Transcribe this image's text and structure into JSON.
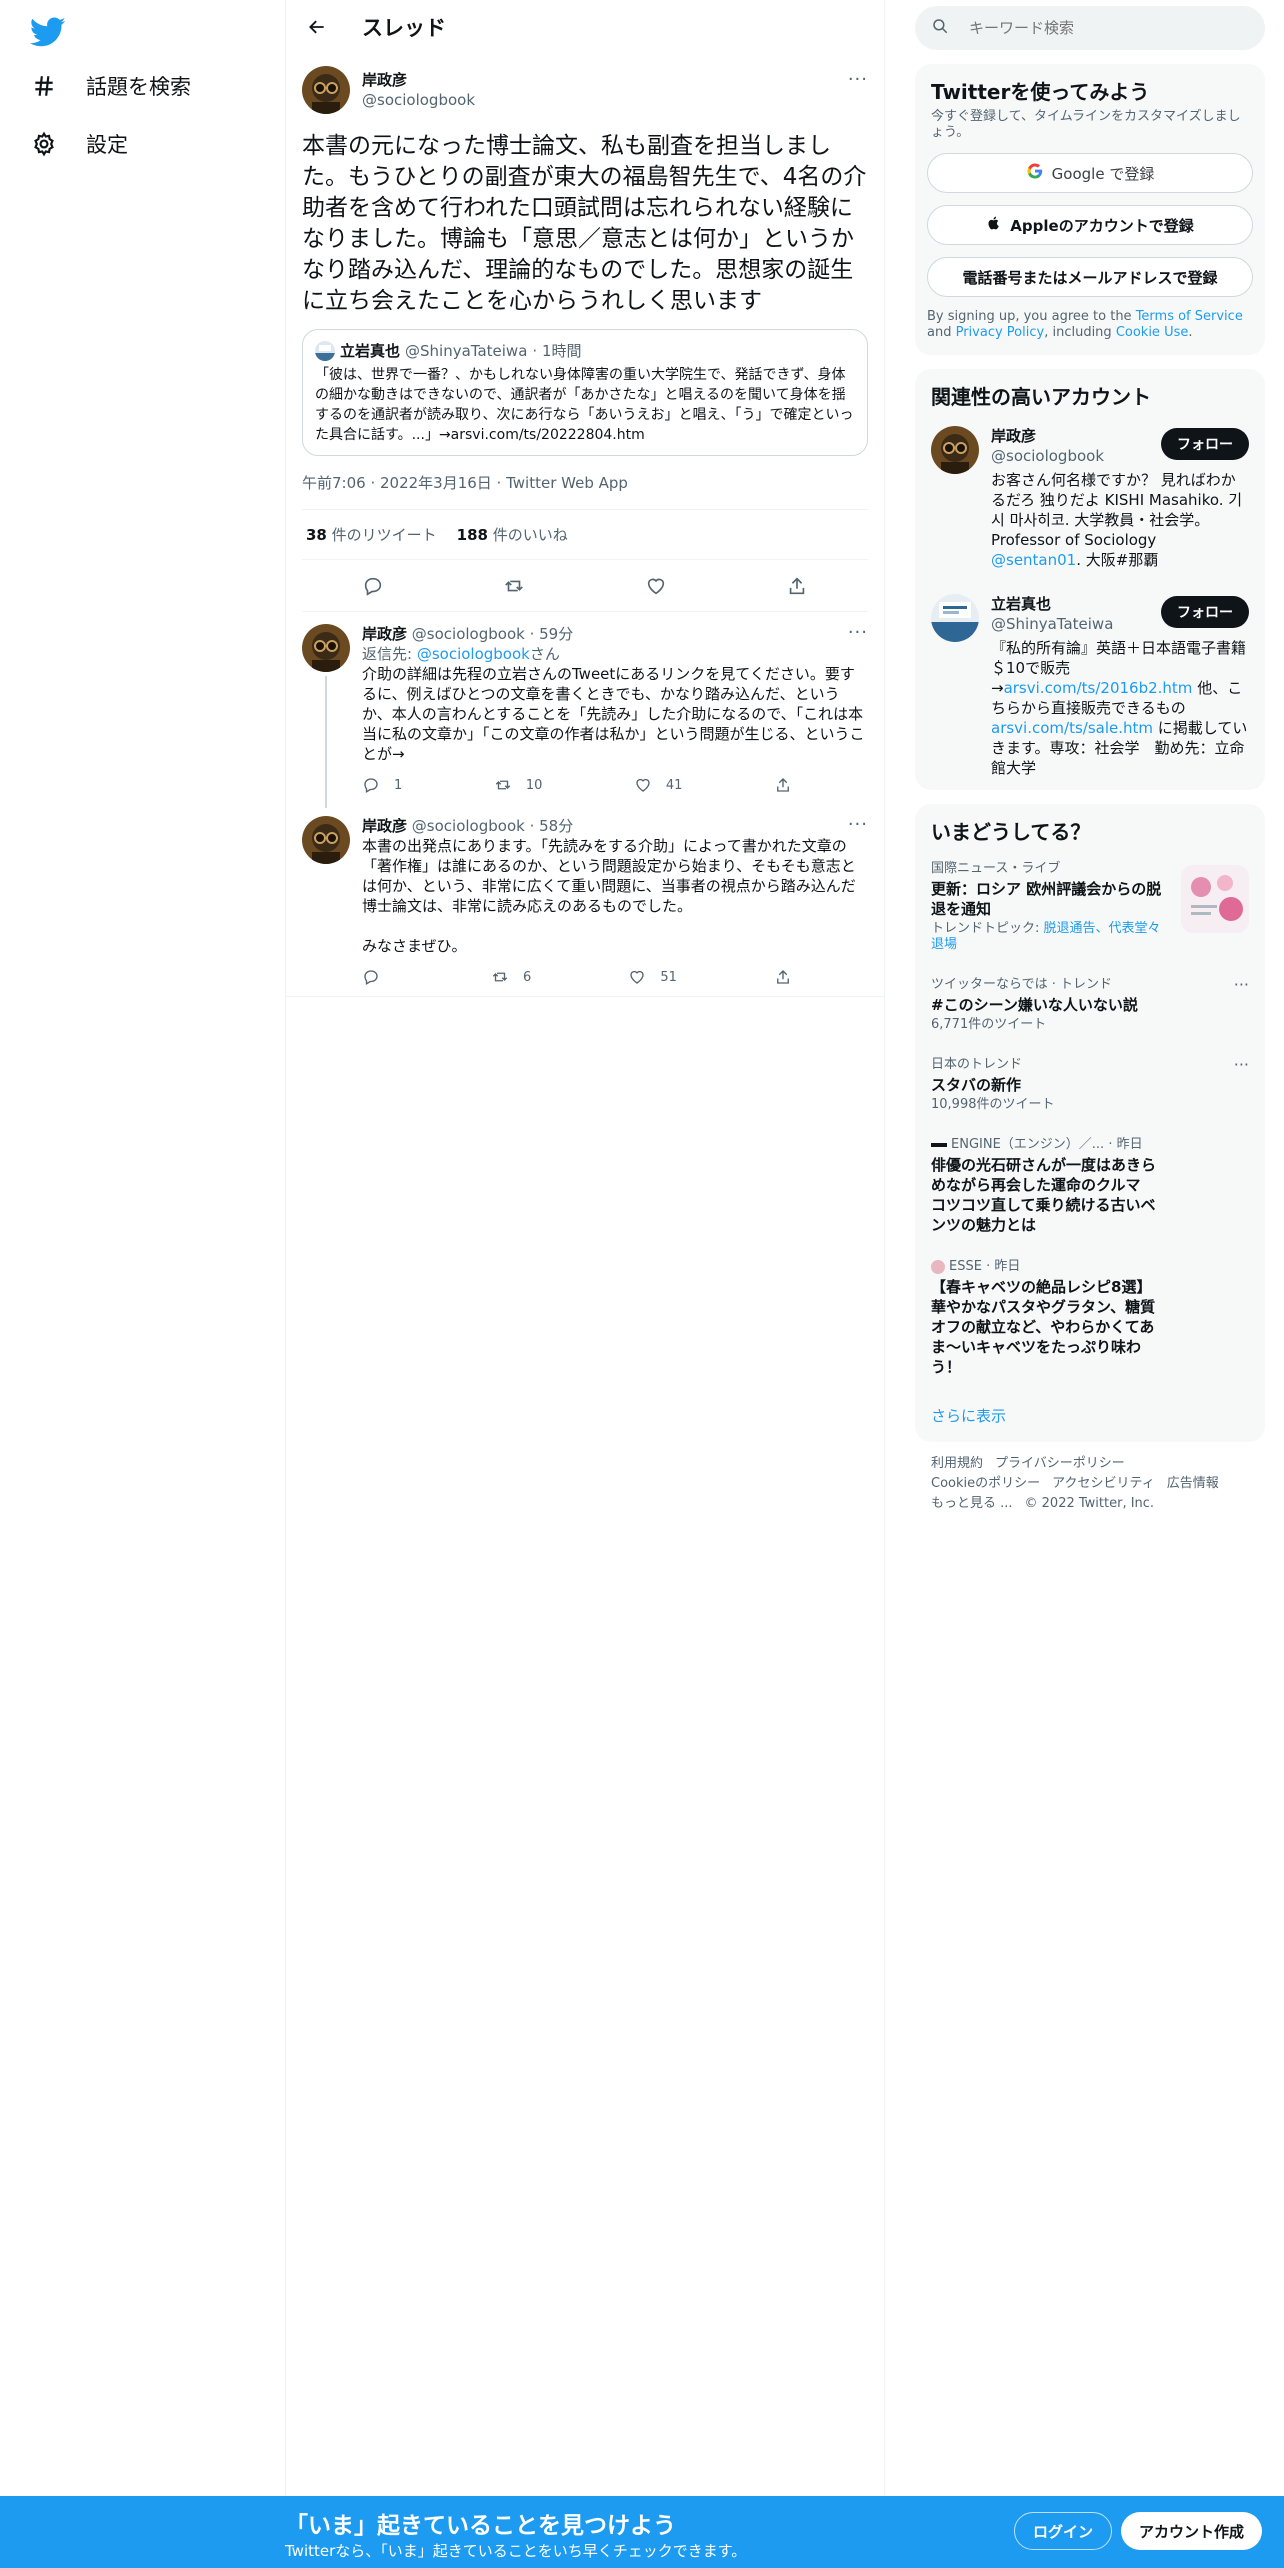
{
  "nav": {
    "items": [
      {
        "icon": "hashtag-icon",
        "label": "話題を検索"
      },
      {
        "icon": "gear-icon",
        "label": "設定"
      }
    ]
  },
  "header": {
    "title": "スレッド"
  },
  "main_tweet": {
    "name": "岸政彦",
    "handle": "@sociologbook",
    "text": "本書の元になった博士論文、私も副査を担当しました。もうひとりの副査が東大の福島智先生で、4名の介助者を含めて行われた口頭試問は忘れられない経験になりました。博論も「意思／意志とは何か」というかなり踏み込んだ、理論的なものでした。思想家の誕生に立ち会えたことを心からうれしく思います",
    "quote": {
      "name": "立岩真也",
      "handle": "@ShinyaTateiwa",
      "time": "· 1時間",
      "text": "「彼は、世界で一番？、かもしれない身体障害の重い大学院生で、発話できず、身体の細かな動きはできないので、通訳者が「あかさたな」と唱えるのを聞いて身体を揺するのを通訳者が読み取り、次にあ行なら「あいうえお」と唱え、「う」で確定といった具合に話す。...」→arsvi.com/ts/20222804.htm"
    },
    "meta": "午前7:06 · 2022年3月16日 · Twitter Web App",
    "retweets_count": "38",
    "retweets_label": "件のリツイート",
    "likes_count": "188",
    "likes_label": "件のいいね"
  },
  "replies": [
    {
      "name": "岸政彦",
      "handle": "@sociologbook",
      "time": "· 59分",
      "reply_prefix": "返信先: ",
      "reply_to": "@sociologbook",
      "reply_suffix": "さん",
      "text": "介助の詳細は先程の立岩さんのTweetにあるリンクを見てください。要するに、例えばひとつの文章を書くときでも、かなり踏み込んだ、というか、本人の言わんとすることを「先読み」した介助になるので、「これは本当に私の文章か」「この文章の作者は私か」という問題が生じる、ということが→",
      "replies": "1",
      "retweets": "10",
      "likes": "41"
    },
    {
      "name": "岸政彦",
      "handle": "@sociologbook",
      "time": "· 58分",
      "text": "本書の出発点にあります。「先読みをする介助」によって書かれた文章の「著作権」は誰にあるのか、という問題設定から始まり、そもそも意志とは何か、という、非常に広くて重い問題に、当事者の視点から踏み込んだ博士論文は、非常に読み応えのあるものでした。\n\nみなさまぜひ。",
      "replies": "",
      "retweets": "6",
      "likes": "51"
    }
  ],
  "search": {
    "placeholder": "キーワード検索"
  },
  "signup": {
    "title": "Twitterを使ってみよう",
    "subtitle": "今すぐ登録して、タイムラインをカスタマイズしましょう。",
    "google": "Google で登録",
    "apple": "Appleのアカウントで登録",
    "phone": "電話番号またはメールアドレスで登録",
    "legal_1": "By signing up, you agree to the ",
    "terms": "Terms of Service",
    "legal_2": " and ",
    "privacy": "Privacy Policy",
    "legal_3": ", including ",
    "cookie": "Cookie Use",
    "legal_4": "."
  },
  "related": {
    "title": "関連性の高いアカウント",
    "follow_label": "フォロー",
    "accounts": [
      {
        "name": "岸政彦",
        "handle": "@sociologbook",
        "bio": "お客さん何名様ですか？ 見ればわかるだろ 独りだよ KISHI Masahiko. 기시 마사히코. 大学教員・社会学。Professor of Sociology ",
        "bio_link": "@sentan01",
        "bio_end": ". 大阪#那覇"
      },
      {
        "name": "立岩真也",
        "handle": "@ShinyaTateiwa",
        "bio": "『私的所有論』英語＋日本語電子書籍＄10で販売→",
        "bio_link": "arsvi.com/ts/2016b2.htm",
        "bio_mid": " 他、こちらから直接販売できるもの ",
        "bio_link2": "arsvi.com/ts/sale.htm",
        "bio_end": " に掲載していきます。専攻：社会学　勤め先：立命館大学"
      }
    ]
  },
  "trends": {
    "title": "いまどうしてる？",
    "items": [
      {
        "context": "国際ニュース・ライブ",
        "title": "更新：ロシア 欧州評議会からの脱退を通知",
        "topics_label": "トレンドトピック: ",
        "topics": "脱退通告、代表堂々退場"
      },
      {
        "context": "ツイッターならでは · トレンド",
        "title": "#このシーン嫌いな人いない説",
        "stat": "6,771件のツイート"
      },
      {
        "context": "日本のトレンド",
        "title": "スタバの新作",
        "stat": "10,998件のツイート"
      },
      {
        "context": "ENGINE（エンジン）／... · 昨日",
        "title": "俳優の光石研さんが一度はあきらめながら再会した運命のクルマ コツコツ直して乗り続ける古いベンツの魅力とは"
      },
      {
        "context": "ESSE · 昨日",
        "title": "【春キャベツの絶品レシピ8選】華やかなパスタやグラタン、糖質オフの献立など、やわらかくてあま〜いキャベツをたっぷり味わう！"
      }
    ],
    "show_more": "さらに表示"
  },
  "footer": {
    "links": [
      "利用規約",
      "プライバシーポリシー",
      "Cookieのポリシー",
      "アクセシビリティ",
      "広告情報",
      "もっと見る ..."
    ],
    "copyright": "© 2022 Twitter, Inc."
  },
  "banner": {
    "headline": "「いま」起きていることを見つけよう",
    "sub": "Twitterなら、「いま」起きていることをいち早くチェックできます。",
    "login": "ログイン",
    "signup": "アカウント作成"
  },
  "colors": {
    "accent": "#1d9bf0",
    "text": "#0f1419",
    "muted": "#536471",
    "panel": "#f7f9f9"
  }
}
